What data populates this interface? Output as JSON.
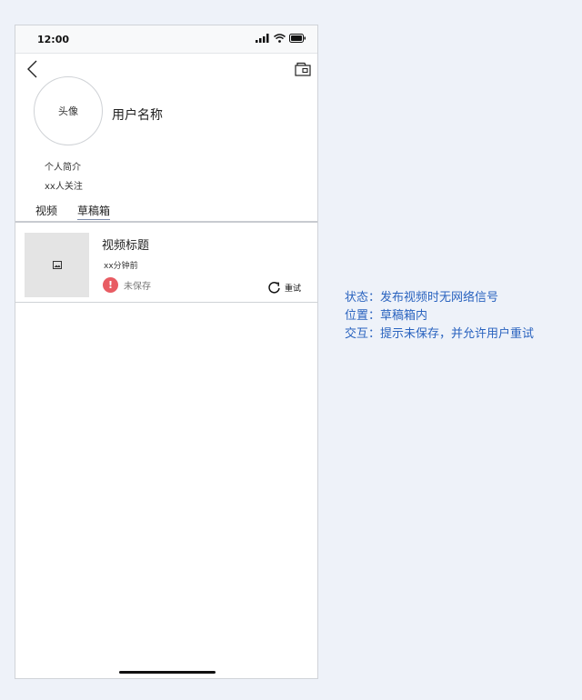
{
  "status_bar": {
    "time": "12:00",
    "icons": [
      "signal-icon",
      "wifi-icon",
      "battery-icon"
    ]
  },
  "header": {
    "back_icon": "chevron-left-icon",
    "right_icon": "wallet-icon"
  },
  "profile": {
    "avatar_label": "头像",
    "username": "用户名称",
    "bio": "个人简介",
    "followers": "xx人关注"
  },
  "tabs": [
    {
      "label": "视频",
      "active": false
    },
    {
      "label": "草稿箱",
      "active": true
    }
  ],
  "draft_item": {
    "thumbnail_icon": "image-placeholder-icon",
    "title": "视频标题",
    "time": "xx分钟前",
    "status_icon": "warning-icon",
    "status_icon_glyph": "!",
    "status": "未保存",
    "retry_icon": "refresh-icon",
    "retry_label": "重试"
  },
  "annotation": {
    "lines": [
      "状态：发布视频时无网络信号",
      "位置：草稿箱内",
      "交互：提示未保存，并允许用户重试"
    ]
  },
  "colors": {
    "background": "#eef2f9",
    "note_blue": "#2a63bf",
    "warning_red": "#e85c63",
    "thumbnail_gray": "#e4e4e4"
  }
}
